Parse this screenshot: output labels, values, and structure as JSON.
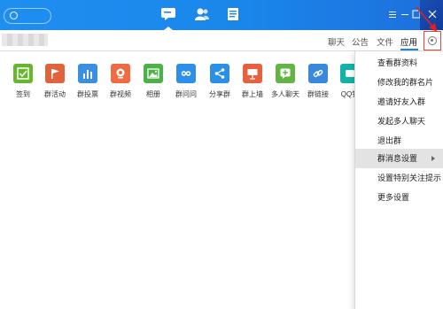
{
  "titlebar": {
    "nav_icons": [
      "chat-icon",
      "contacts-icon",
      "files-icon"
    ],
    "window_controls": [
      "menu-icon",
      "minimize-icon",
      "maximize-icon",
      "close-icon"
    ],
    "accent": "#1a86ea"
  },
  "subheader": {
    "tabs": [
      "聊天",
      "公告",
      "文件",
      "应用"
    ],
    "active_tab": "应用"
  },
  "apps": [
    {
      "label": "签到",
      "color": "#6ab52e",
      "icon": "checkbox-icon"
    },
    {
      "label": "群活动",
      "color": "#e0633b",
      "icon": "flag-icon"
    },
    {
      "label": "群投票",
      "color": "#3b8fe0",
      "icon": "bar-chart-icon"
    },
    {
      "label": "群视频",
      "color": "#ee6b44",
      "icon": "camera-icon"
    },
    {
      "label": "相册",
      "color": "#4db14a",
      "icon": "image-icon"
    },
    {
      "label": "群问问",
      "color": "#2d8fe8",
      "icon": "owl-icon"
    },
    {
      "label": "分享群",
      "color": "#2b8fe6",
      "icon": "share-icon"
    },
    {
      "label": "群上墙",
      "color": "#e8613f",
      "icon": "presentation-icon"
    },
    {
      "label": "多人聊天",
      "color": "#63b443",
      "icon": "chat-plus-icon"
    },
    {
      "label": "群链接",
      "color": "#3a88dd",
      "icon": "link-icon"
    },
    {
      "label": "QQ钱",
      "color": "#12b3a8",
      "icon": "wallet-icon"
    }
  ],
  "menu": {
    "items": [
      {
        "label": "查看群资料"
      },
      {
        "label": "修改我的群名片"
      },
      {
        "label": "邀请好友入群"
      },
      {
        "label": "发起多人聊天"
      },
      {
        "label": "退出群"
      },
      {
        "label": "群消息设置",
        "has_submenu": true,
        "highlighted": true
      },
      {
        "label": "设置特别关注提示"
      },
      {
        "label": "更多设置"
      }
    ]
  }
}
